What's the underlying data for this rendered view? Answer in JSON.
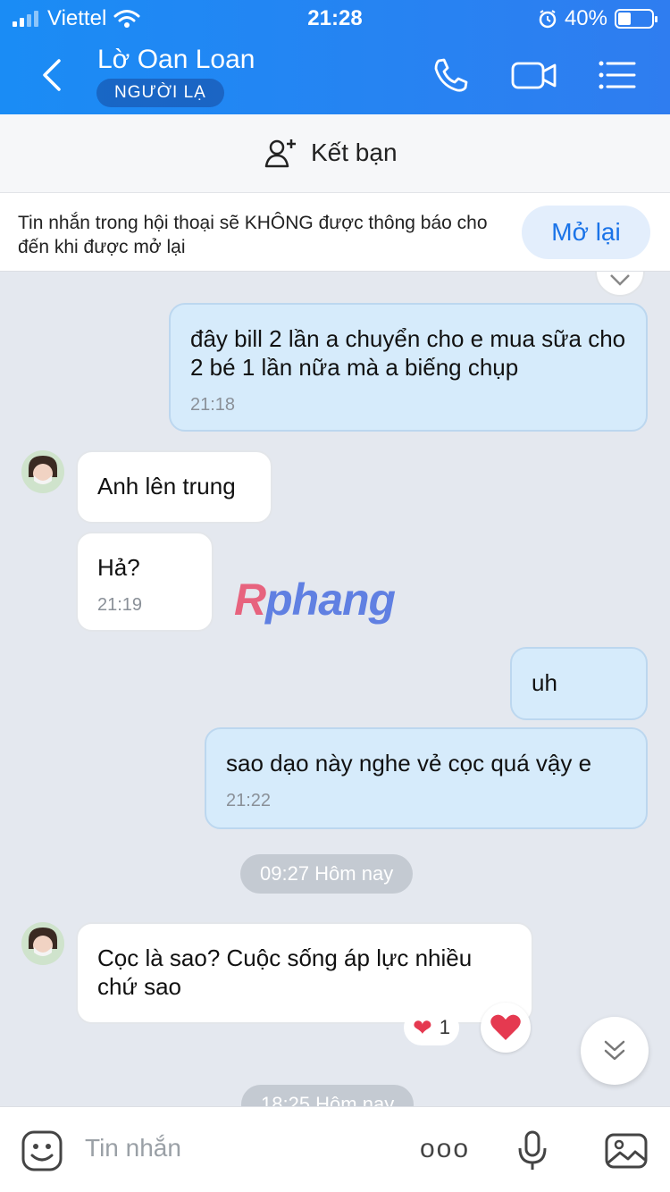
{
  "status": {
    "carrier": "Viettel",
    "time": "21:28",
    "battery": "40%"
  },
  "header": {
    "name": "Lờ Oan Loan",
    "badge": "NGƯỜI LẠ"
  },
  "add_friend": {
    "label": "Kết bạn"
  },
  "notice": {
    "text": "Tin nhắn trong hội thoại sẽ KHÔNG được thông báo cho đến khi được mở lại",
    "button": "Mở lại"
  },
  "messages": [
    {
      "dir": "out",
      "text": "đây bill 2 lần a chuyển cho e mua sữa cho 2 bé 1 lần nữa mà a biếng chụp",
      "time": "21:18"
    },
    {
      "dir": "in",
      "text": "Anh lên trung"
    },
    {
      "dir": "in",
      "text": "Hả?",
      "time": "21:19"
    },
    {
      "dir": "out",
      "text": "uh"
    },
    {
      "dir": "out",
      "text": "sao dạo này nghe vẻ cọc quá vậy e",
      "time": "21:22"
    },
    {
      "dir": "in",
      "text": "Cọc là sao? Cuộc sống áp lực nhiều chứ sao"
    }
  ],
  "time_pills": [
    "09:27 Hôm nay",
    "18:25 Hôm nay"
  ],
  "reaction": {
    "emoji": "❤",
    "count": "1"
  },
  "watermark": {
    "part1": "R",
    "part2": "phang"
  },
  "input": {
    "placeholder": "Tin nhắn",
    "more": "ooo"
  }
}
